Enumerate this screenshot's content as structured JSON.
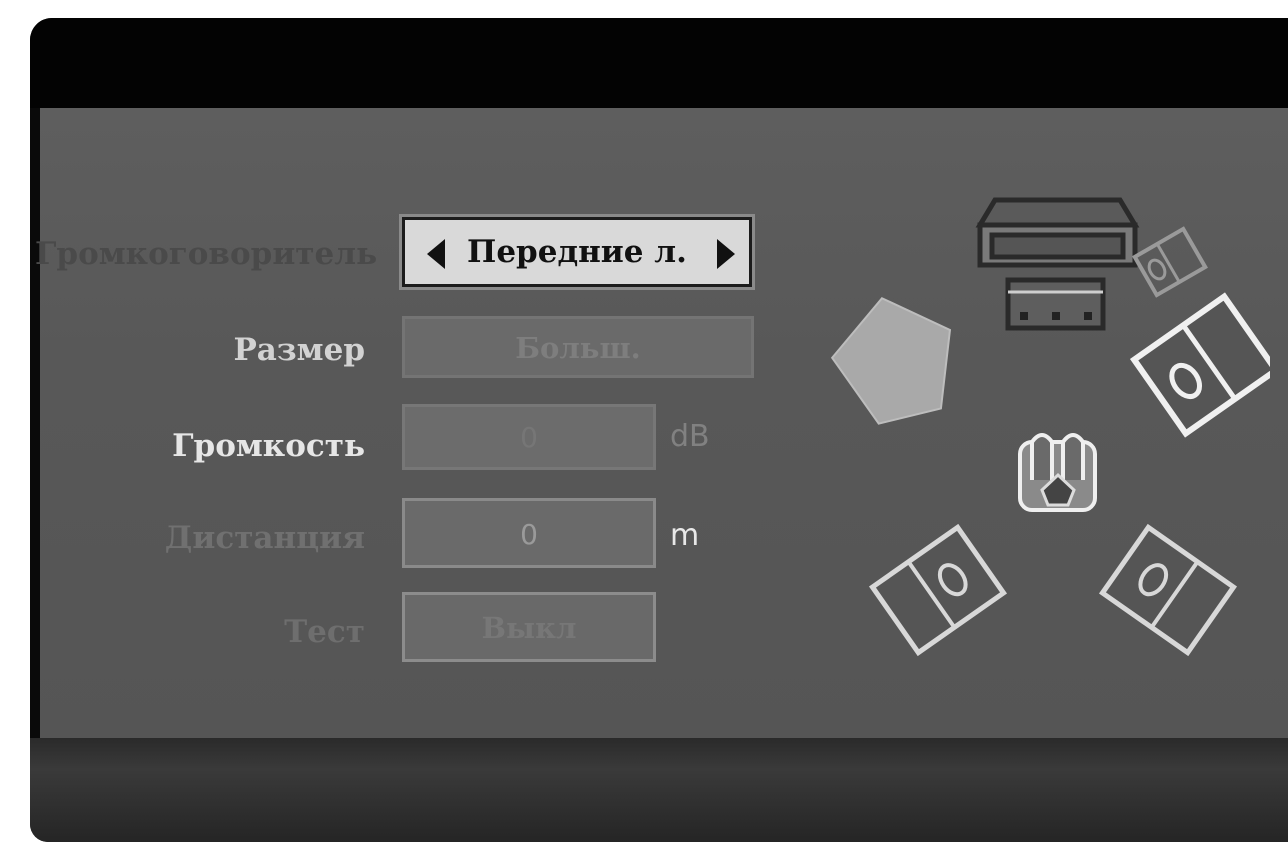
{
  "setup": {
    "speaker_label": "Громкоговоритель",
    "speaker_value": "Передние л.",
    "size_label": "Размер",
    "size_value": "Больш.",
    "volume_label": "Громкость",
    "volume_value": "0",
    "volume_unit": "dB",
    "distance_label": "Дистанция",
    "distance_value": "0",
    "distance_unit": "m",
    "test_label": "Тест",
    "test_value": "Выкл"
  },
  "speaker_layout": {
    "icons": [
      "center-speaker-icon",
      "subwoofer-icon",
      "front-left-speaker-icon",
      "front-right-speaker-icon",
      "front-right-small-speaker-icon",
      "listener-icon",
      "surround-left-speaker-icon",
      "surround-right-speaker-icon"
    ],
    "selected": "front-left-speaker-icon"
  }
}
